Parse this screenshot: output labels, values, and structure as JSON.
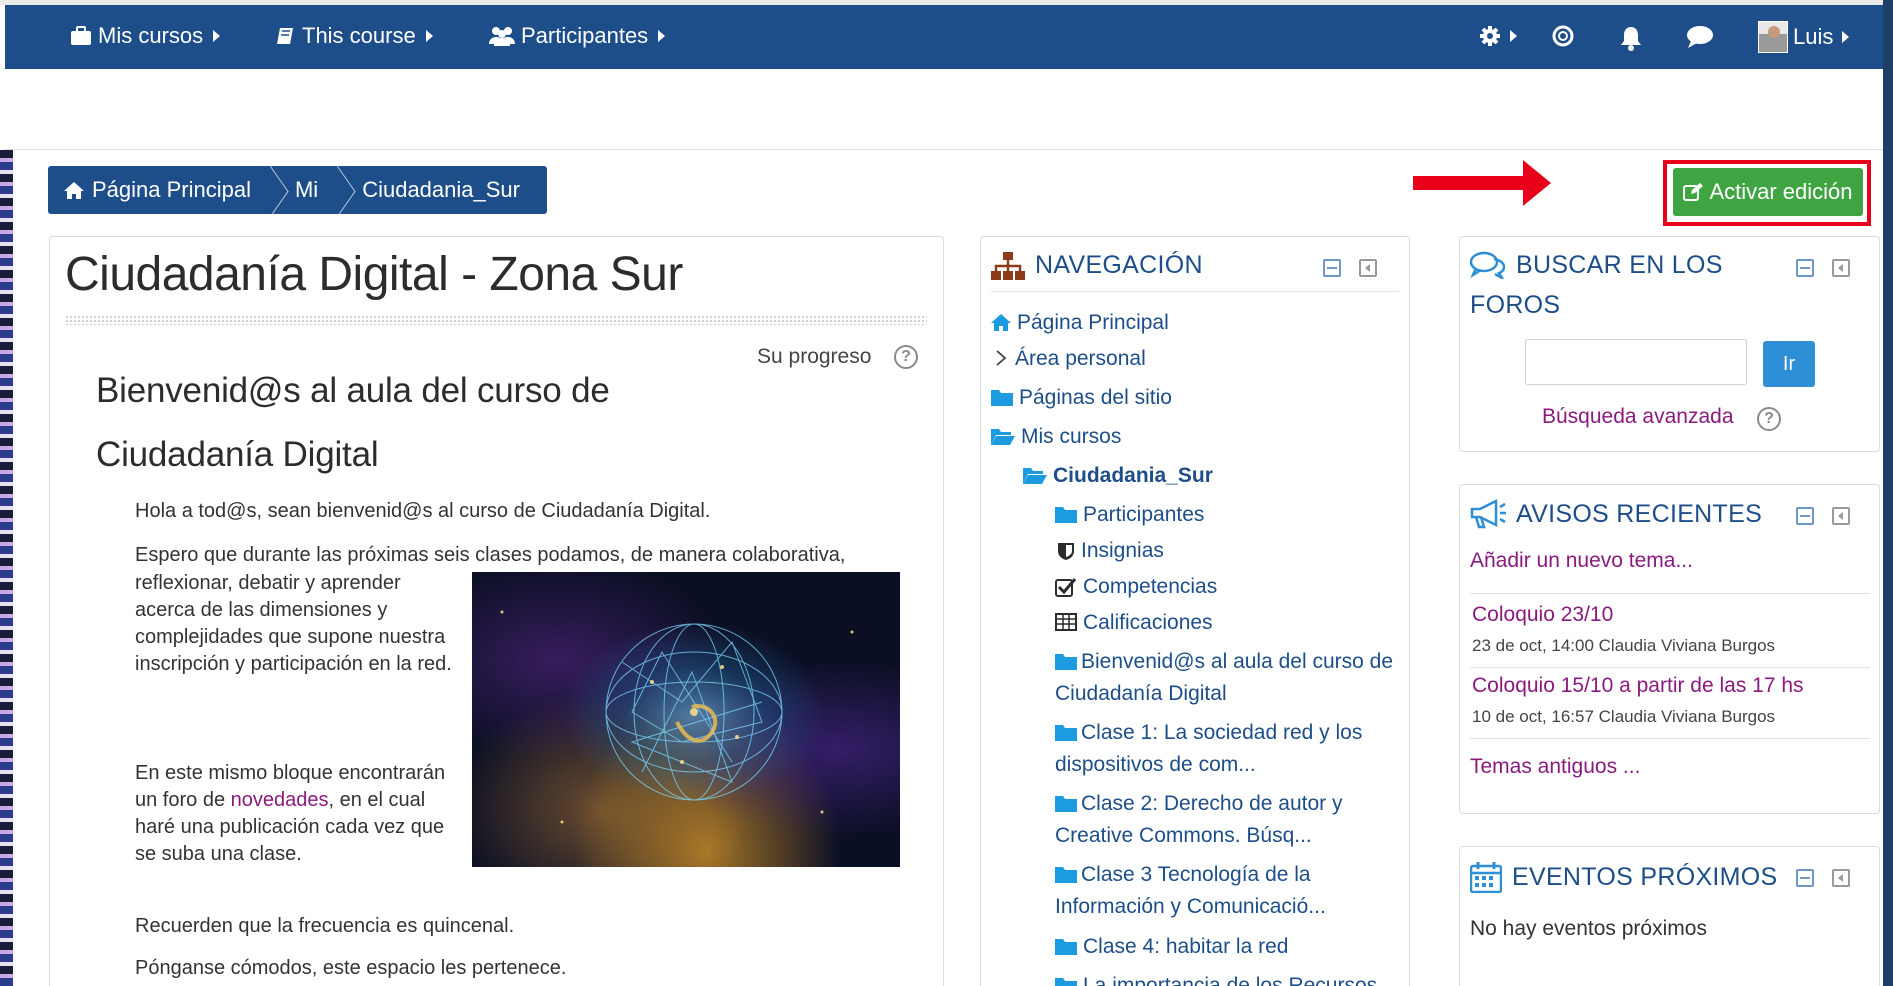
{
  "navbar": {
    "my_courses": "Mis cursos",
    "this_course": "This course",
    "participants": "Participantes",
    "user_name": "Luis",
    "icons": [
      "gear-icon",
      "life-ring-icon",
      "bell-icon",
      "chat-bubble-icon"
    ]
  },
  "breadcrumb": [
    "Página Principal",
    "Mi",
    "Ciudadania_Sur"
  ],
  "edit_button": "Activar edición",
  "colors": {
    "navbar": "#1d4e89",
    "edit_button": "#3fa542",
    "highlight": "#e8001a",
    "link": "#8b1a7e"
  },
  "main": {
    "course_title": "Ciudadanía Digital - Zona Sur",
    "progress_label": "Su progreso",
    "welcome_heading": "Bienvenid@s al aula del curso de Ciudadanía Digital",
    "p1": "Hola a tod@s, sean bienvenid@s al curso de Ciudadanía Digital.",
    "p2": "Espero que durante las próximas seis clases podamos, de manera colaborativa,",
    "p3": "reflexionar, debatir y aprender acerca de las dimensiones y complejidades que supone nuestra inscripción y participación en la red.",
    "p4_before": "En este mismo bloque encontrarán un foro de",
    "p4_link": "novedades",
    "p4_after": ", en el cual haré una publicación cada vez que se suba una clase.",
    "p5": "Recuerden que la frecuencia es quincenal.",
    "p6": "Pónganse cómodos, este espacio les pertenece."
  },
  "navigation": {
    "title": "NAVEGACIÓN",
    "items": [
      "Página Principal",
      "Área personal",
      "Páginas del sitio",
      "Mis cursos",
      "Ciudadania_Sur",
      "Participantes",
      "Insignias",
      "Competencias",
      "Calificaciones",
      "Bienvenid@s al aula del curso de Ciudadanía Digital",
      "Clase 1: La sociedad red y los dispositivos de com...",
      "Clase 2: Derecho de autor y Creative Commons. Búsq...",
      "Clase 3 Tecnología de la Información y Comunicació...",
      "Clase 4: habitar la red",
      "La importancia de los Recursos"
    ]
  },
  "search_forums": {
    "title_line1": "BUSCAR EN LOS",
    "title_line2": "FOROS",
    "input_value": "",
    "go_button": "Ir",
    "advanced": "Búsqueda avanzada"
  },
  "news": {
    "title": "AVISOS RECIENTES",
    "add_topic": "Añadir un nuevo tema...",
    "posts": [
      {
        "title": "Coloquio 23/10",
        "meta": "23 de oct, 14:00  Claudia Viviana Burgos"
      },
      {
        "title": "Coloquio 15/10 a partir de las 17 hs",
        "meta": "10 de oct, 16:57  Claudia Viviana Burgos"
      }
    ],
    "old_topics": "Temas antiguos ..."
  },
  "events": {
    "title": "EVENTOS PRÓXIMOS",
    "empty": "No hay eventos próximos"
  }
}
